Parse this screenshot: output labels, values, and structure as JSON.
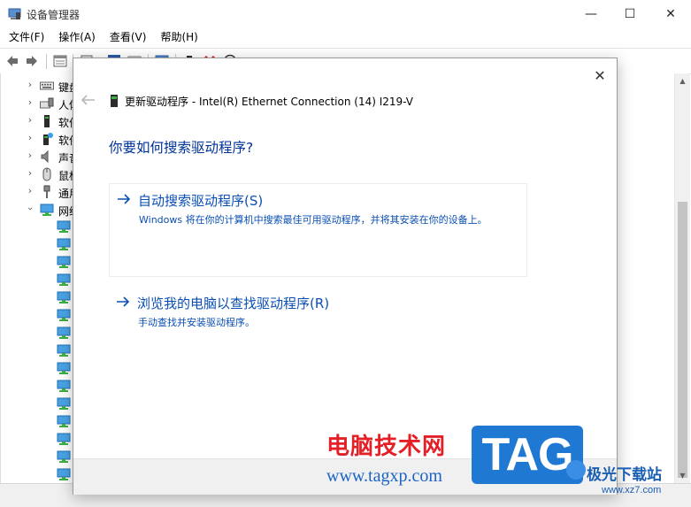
{
  "window": {
    "title": "设备管理器",
    "minimize_glyph": "—",
    "maximize_glyph": "☐",
    "close_glyph": "✕"
  },
  "menu": {
    "items": [
      {
        "label": "文件(F)"
      },
      {
        "label": "操作(A)"
      },
      {
        "label": "查看(V)"
      },
      {
        "label": "帮助(H)"
      }
    ]
  },
  "toolbar": {
    "icons": [
      "back-arrow-icon",
      "forward-arrow-icon",
      "properties-icon",
      "computer-icon",
      "help-icon",
      "list-view-icon",
      "monitor-icon",
      "update-driver-icon",
      "remove-device-icon",
      "scan-hardware-icon"
    ]
  },
  "tree": {
    "categories": [
      {
        "label": "键盘",
        "icon": "keyboard-icon",
        "expanded": false
      },
      {
        "label": "人体",
        "icon": "human-interface-icon",
        "expanded": false
      },
      {
        "label": "软件",
        "icon": "software-component-icon",
        "expanded": false
      },
      {
        "label": "软件",
        "icon": "software-device-icon",
        "expanded": false
      },
      {
        "label": "声音",
        "icon": "speaker-icon",
        "expanded": false
      },
      {
        "label": "鼠标",
        "icon": "mouse-icon",
        "expanded": false
      },
      {
        "label": "通用",
        "icon": "usb-icon",
        "expanded": false
      },
      {
        "label": "网络",
        "icon": "network-adapter-icon",
        "expanded": true
      }
    ],
    "network_child_count_visible": 15
  },
  "dialog": {
    "title": "更新驱动程序 - Intel(R) Ethernet Connection (14) I219-V",
    "close_glyph": "✕",
    "question": "你要如何搜索驱动程序?",
    "options": [
      {
        "title": "自动搜索驱动程序(S)",
        "description": "Windows 将在你的计算机中搜索最佳可用驱动程序，并将其安装在你的设备上。"
      },
      {
        "title": "浏览我的电脑以查找驱动程序(R)",
        "description": "手动查找并安装驱动程序。"
      }
    ]
  },
  "watermark": {
    "site_name": "电脑技术网",
    "url": "www.tagxp.com",
    "tag": "TAG",
    "right_name": "极光下载站",
    "right_url": "www.xz7.com"
  },
  "colors": {
    "dialog_link": "#0a4fb5",
    "question": "#003399",
    "watermark_red": "#e41f26",
    "watermark_blue": "#1f78d1"
  }
}
